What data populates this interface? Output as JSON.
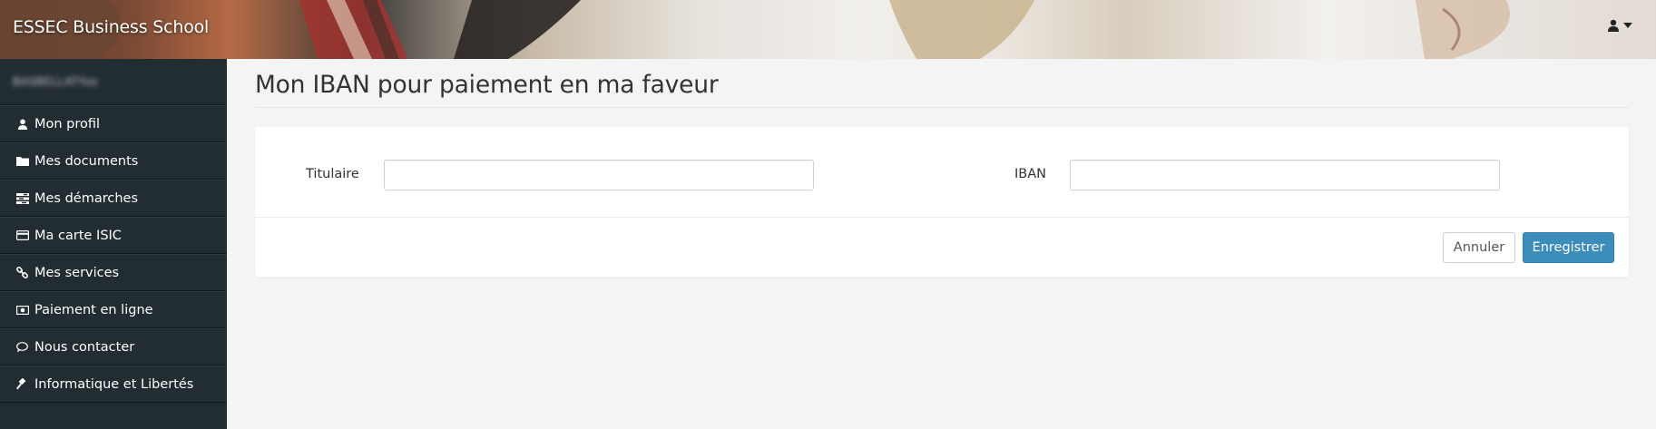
{
  "header": {
    "brand": "ESSEC Business School",
    "user_menu_icon": "user-icon",
    "caret_icon": "caret-down-icon"
  },
  "sidebar": {
    "user_name": "BASBELLATYus",
    "items": [
      {
        "label": "Mon profil",
        "icon": "user-icon"
      },
      {
        "label": "Mes documents",
        "icon": "folder-icon"
      },
      {
        "label": "Mes démarches",
        "icon": "tasks-icon"
      },
      {
        "label": "Ma carte ISIC",
        "icon": "credit-card-icon"
      },
      {
        "label": "Mes services",
        "icon": "link-icon"
      },
      {
        "label": "Paiement en ligne",
        "icon": "money-icon"
      },
      {
        "label": "Nous contacter",
        "icon": "comment-icon"
      },
      {
        "label": "Informatique et Libertés",
        "icon": "gavel-icon"
      }
    ]
  },
  "main": {
    "title": "Mon IBAN pour paiement en ma faveur",
    "form": {
      "holder_label": "Titulaire",
      "holder_value": "",
      "iban_label": "IBAN",
      "iban_value": ""
    },
    "actions": {
      "cancel_label": "Annuler",
      "save_label": "Enregistrer"
    }
  },
  "colors": {
    "sidebar_bg": "#222d32",
    "primary": "#3c8dbc",
    "page_bg": "#f4f4f4"
  }
}
